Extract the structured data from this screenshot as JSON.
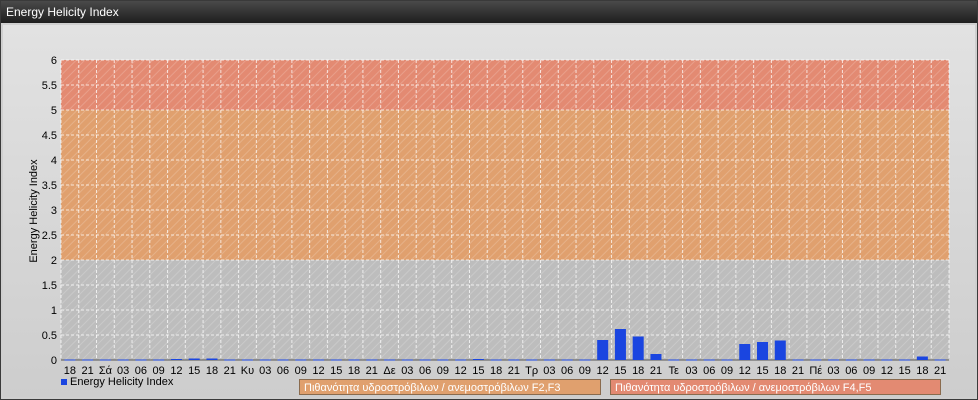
{
  "window": {
    "title": "Energy Helicity Index"
  },
  "chart_data": {
    "type": "bar",
    "title": "",
    "ylabel": "Energy Helicity Index",
    "xlabel": "",
    "ylim": [
      0,
      6
    ],
    "yticks": [
      "0",
      "0.5",
      "1",
      "1.5",
      "2",
      "2.5",
      "3",
      "3.5",
      "4",
      "4.5",
      "5",
      "5.5",
      "6"
    ],
    "bands": [
      {
        "from": 0,
        "to": 2,
        "color": "#bdbdbd"
      },
      {
        "from": 2,
        "to": 5,
        "color": "#e0a06e"
      },
      {
        "from": 5,
        "to": 6,
        "color": "#e38a72"
      }
    ],
    "categories": [
      "18",
      "21",
      "Σά",
      "03",
      "06",
      "09",
      "12",
      "15",
      "18",
      "21",
      "Κυ",
      "03",
      "06",
      "09",
      "12",
      "15",
      "18",
      "21",
      "Δε",
      "03",
      "06",
      "09",
      "12",
      "15",
      "18",
      "21",
      "Τρ",
      "03",
      "06",
      "09",
      "12",
      "15",
      "18",
      "21",
      "Τε",
      "03",
      "06",
      "09",
      "12",
      "15",
      "18",
      "21",
      "Πέ",
      "03",
      "06",
      "09",
      "12",
      "15",
      "18",
      "21"
    ],
    "series": [
      {
        "name": "Energy Helicity Index",
        "color": "#1a45e0",
        "values": [
          0.01,
          0.01,
          0.01,
          0.01,
          0.01,
          0.01,
          0.02,
          0.03,
          0.03,
          0.01,
          0.01,
          0.01,
          0.01,
          0.01,
          0.01,
          0.01,
          0.01,
          0.01,
          0.01,
          0.01,
          0.01,
          0.01,
          0.01,
          0.02,
          0.01,
          0.01,
          0.01,
          0.01,
          0.01,
          0.01,
          0.4,
          0.62,
          0.47,
          0.12,
          0.01,
          0.01,
          0.01,
          0.01,
          0.32,
          0.36,
          0.39,
          0.01,
          0.01,
          0.01,
          0.01,
          0.01,
          0.01,
          0.01,
          0.07,
          0.01
        ]
      }
    ],
    "grid": true,
    "legend_position": "bottom-left"
  },
  "bottom_labels": [
    {
      "text": "Πιθανότητα υδροστρόβιλων / ανεμοστρόβιλων F2,F3",
      "color": "#e0a06e"
    },
    {
      "text": "Πιθανότητα υδροστρόβιλων / ανεμοστρόβιλων F4,F5",
      "color": "#e38a72"
    }
  ]
}
